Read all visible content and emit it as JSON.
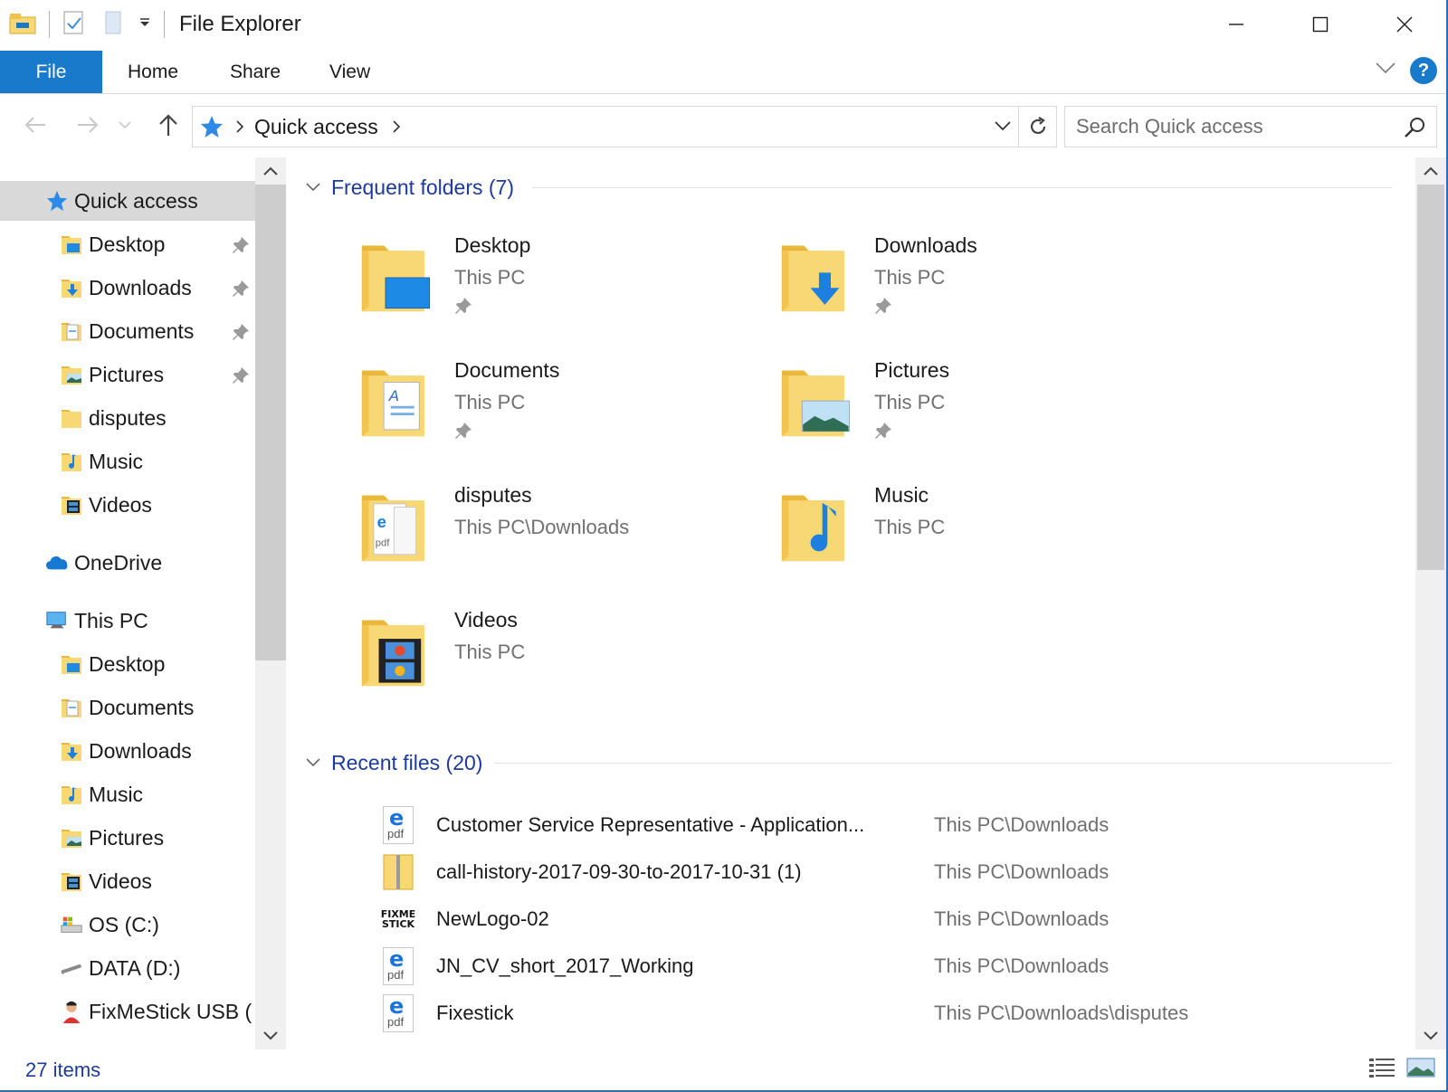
{
  "window": {
    "title": "File Explorer"
  },
  "ribbon": {
    "tabs": [
      "File",
      "Home",
      "Share",
      "View"
    ],
    "help_label": "?"
  },
  "address": {
    "breadcrumb": "Quick access",
    "search_placeholder": "Search Quick access"
  },
  "navpane": {
    "items": [
      {
        "label": "Quick access",
        "icon": "star-icon",
        "level": 0,
        "selected": true
      },
      {
        "label": "Desktop",
        "icon": "desktop-folder-icon",
        "level": 1,
        "pinned": true
      },
      {
        "label": "Downloads",
        "icon": "downloads-folder-icon",
        "level": 1,
        "pinned": true
      },
      {
        "label": "Documents",
        "icon": "documents-folder-icon",
        "level": 1,
        "pinned": true
      },
      {
        "label": "Pictures",
        "icon": "pictures-folder-icon",
        "level": 1,
        "pinned": true
      },
      {
        "label": "disputes",
        "icon": "folder-icon",
        "level": 1
      },
      {
        "label": "Music",
        "icon": "music-folder-icon",
        "level": 1
      },
      {
        "label": "Videos",
        "icon": "videos-folder-icon",
        "level": 1
      },
      {
        "label": "OneDrive",
        "icon": "onedrive-icon",
        "level": 0
      },
      {
        "label": "This PC",
        "icon": "computer-icon",
        "level": 0
      },
      {
        "label": "Desktop",
        "icon": "desktop-folder-icon",
        "level": 1
      },
      {
        "label": "Documents",
        "icon": "documents-folder-icon",
        "level": 1
      },
      {
        "label": "Downloads",
        "icon": "downloads-folder-icon",
        "level": 1
      },
      {
        "label": "Music",
        "icon": "music-folder-icon",
        "level": 1
      },
      {
        "label": "Pictures",
        "icon": "pictures-folder-icon",
        "level": 1
      },
      {
        "label": "Videos",
        "icon": "videos-folder-icon",
        "level": 1
      },
      {
        "label": "OS (C:)",
        "icon": "os-drive-icon",
        "level": 1
      },
      {
        "label": "DATA (D:)",
        "icon": "drive-icon",
        "level": 1
      },
      {
        "label": "FixMeStick USB (",
        "icon": "usb-drive-icon",
        "level": 1
      }
    ]
  },
  "frequent": {
    "header": "Frequent folders (7)",
    "folders": [
      {
        "name": "Desktop",
        "location": "This PC",
        "pinned": true,
        "icon": "desktop-folder-icon"
      },
      {
        "name": "Downloads",
        "location": "This PC",
        "pinned": true,
        "icon": "downloads-folder-icon"
      },
      {
        "name": "Documents",
        "location": "This PC",
        "pinned": true,
        "icon": "documents-folder-icon"
      },
      {
        "name": "Pictures",
        "location": "This PC",
        "pinned": true,
        "icon": "pictures-folder-icon"
      },
      {
        "name": "disputes",
        "location": "This PC\\Downloads",
        "pinned": false,
        "icon": "folder-icon"
      },
      {
        "name": "Music",
        "location": "This PC",
        "pinned": false,
        "icon": "music-folder-icon"
      },
      {
        "name": "Videos",
        "location": "This PC",
        "pinned": false,
        "icon": "videos-folder-icon"
      }
    ]
  },
  "recent": {
    "header": "Recent files (20)",
    "files": [
      {
        "name": "Customer Service Representative - Application...",
        "path": "This PC\\Downloads",
        "icon": "pdf-icon"
      },
      {
        "name": "call-history-2017-09-30-to-2017-10-31 (1)",
        "path": "This PC\\Downloads",
        "icon": "zip-folder-icon"
      },
      {
        "name": "NewLogo-02",
        "path": "This PC\\Downloads",
        "icon": "fixmestick-logo-icon",
        "logo_text": "FIXME STICK"
      },
      {
        "name": "JN_CV_short_2017_Working",
        "path": "This PC\\Downloads",
        "icon": "pdf-icon"
      },
      {
        "name": "Fixestick",
        "path": "This PC\\Downloads\\disputes",
        "icon": "pdf-icon"
      }
    ]
  },
  "status": {
    "item_count": "27 items"
  },
  "colors": {
    "accent": "#1979ca",
    "group_header": "#1e3a9a",
    "folder": "#f8d775",
    "selection": "#d9d9d9"
  }
}
